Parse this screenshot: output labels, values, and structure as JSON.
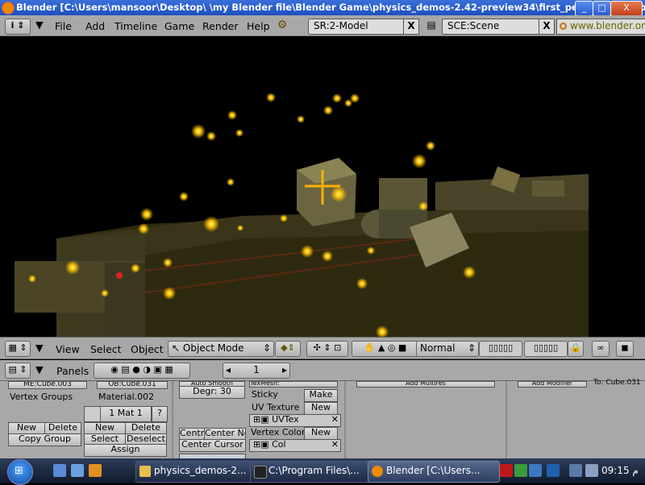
{
  "window": {
    "title": "Blender [C:\\Users\\mansoor\\Desktop\\  \\my Blender file\\Blender Game\\physics_demos-2.42-preview34\\first_person_bullet.blend]",
    "min": "_",
    "max": "□",
    "close": "X"
  },
  "top_header": {
    "menus": [
      "File",
      "Add",
      "Timeline",
      "Game",
      "Render",
      "Help"
    ],
    "screen_field": "SR:2-Model",
    "scene_field": "SCE:Scene",
    "close_x": "X",
    "url": "www.blender.org"
  },
  "view_header": {
    "menus": [
      "View",
      "Select",
      "Object"
    ],
    "mode": "Object Mode",
    "shading": "Normal"
  },
  "buttons_header": {
    "panels_label": "Panels",
    "frame": "1"
  },
  "link_panel": {
    "me_field": "ME:Cube.003",
    "ob_field": "OB:Cube.031",
    "vertex_groups": "Vertex Groups",
    "material": "Material.002",
    "mat_slot": "1 Mat 1",
    "question": "?",
    "new1": "New",
    "delete1": "Delete",
    "copy_group": "Copy Group",
    "new2": "New",
    "delete2": "Delete",
    "select": "Select",
    "deselect": "Deselect",
    "assign": "Assign"
  },
  "mesh_panel": {
    "auto_smooth": "Auto Smooth",
    "degr": "Degr: 30",
    "centre": "Centre",
    "center_new": "Center New",
    "center_cursor": "Center Cursor"
  },
  "texture_panel": {
    "texmesh": "TexMesh:",
    "sticky": "Sticky",
    "make": "Make",
    "uv_texture": "UV Texture",
    "new_uv": "New",
    "uvtex": "UVTex",
    "vertex_color": "Vertex Color",
    "new_vc": "New",
    "col": "Col"
  },
  "modifiers": {
    "add_multires": "Add Multires",
    "add_modifier": "Add Modifier",
    "to_label": "To: Cube.031"
  },
  "taskbar": {
    "tasks": [
      "physics_demos-2...",
      "C:\\Program Files\\...",
      "Blender [C:\\Users..."
    ],
    "clock": "09:15 م"
  },
  "colors": {
    "blender_gray": "#a8a8a8",
    "title_blue": "#2a5bd0",
    "glow": "#ffc400"
  }
}
